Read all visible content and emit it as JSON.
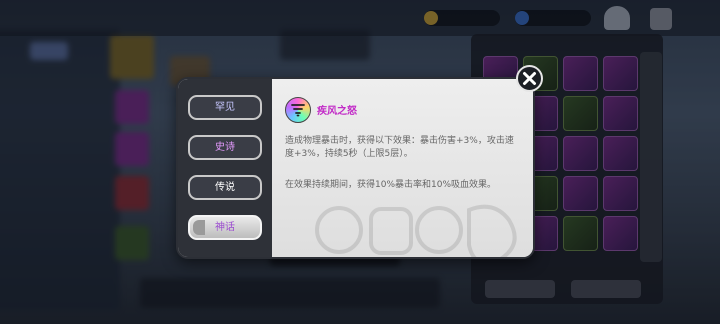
{
  "colors": {
    "legendary_text": "#c22ac7",
    "dialog_bg": "#e6e6e6",
    "tab_dark": "#3a3d46"
  },
  "rarity_tabs": [
    {
      "label": "罕见",
      "color": "#c7c7ff",
      "active": false
    },
    {
      "label": "史诗",
      "color": "#e59bff",
      "active": false
    },
    {
      "label": "传说",
      "color": "#ffffff",
      "active": false
    },
    {
      "label": "神话",
      "color": "#9b4bd0",
      "active": true
    }
  ],
  "item": {
    "icon": "whirlwind-icon",
    "name": "疾风之怒",
    "description_1": "造成物理暴击时，获得以下效果：暴击伤害+3%，攻击速度+3%，持续5秒（上限5层）。",
    "description_2": "在效果持续期间，获得10%暴击率和10%吸血效果。"
  },
  "close_icon": "close-icon"
}
